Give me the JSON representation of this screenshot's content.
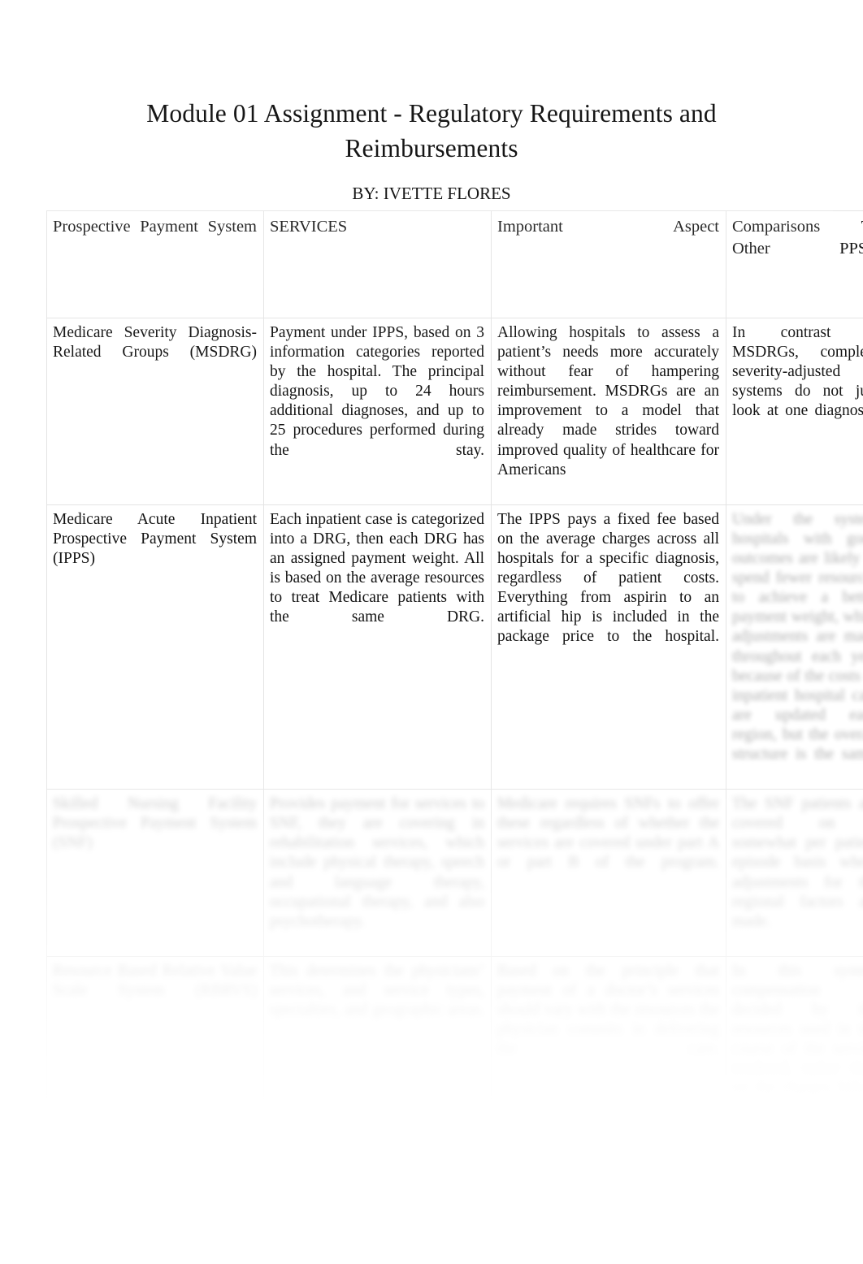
{
  "document": {
    "title": "Module 01 Assignment - Regulatory Requirements and Reimbursements",
    "byline": "BY: IVETTE FLORES"
  },
  "table": {
    "headers": [
      "Prospective Payment System",
      "SERVICES",
      "Important Aspect",
      "Comparisons To Other PPS’s"
    ],
    "rows": [
      {
        "system": "Medicare Severity Diagnosis-Related Groups (MSDRG)",
        "services": "Payment under IPPS, based on 3 information categories reported by the hospital. The principal diagnosis, up to 24 hours additional diagnoses, and up to 25 procedures performed during the stay.",
        "important_aspect": "Allowing hospitals to assess a patient’s needs more accurately without fear of hampering reimbursement. MSDRGs are an improvement to a model that already made strides toward improved quality of healthcare for Americans",
        "comparisons": "In contrast to MSDRGs, complete severity-adjusted systems do not just look at one diagnosis."
      },
      {
        "system": "Medicare Acute Inpatient Prospective Payment System (IPPS)",
        "services": "Each inpatient case is categorized into a DRG, then each DRG has an assigned payment weight. All is based on the average resources to treat Medicare patients with the same DRG.",
        "important_aspect": "The IPPS pays a fixed fee based on the average charges across all hospitals for a specific diagnosis, regardless of patient costs. Everything from aspirin to an artificial hip is included in the package price to the hospital.",
        "comparisons": "Under the system hospitals with good outcomes are likely to spend fewer resources to achieve a better payment weight, while adjustments are made throughout each year because of the costs of inpatient hospital care are updated each region, but the overall structure is the same."
      },
      {
        "system": "Skilled Nursing Facility Prospective Payment System (SNF)",
        "services": "Provides payment for services to SNF, they are covering in rehabilitation services, which include physical therapy, speech and language therapy, occupational therapy, and also psychotherapy.",
        "important_aspect": "Medicare requires SNFs to offer these regardless of whether the services are covered under part A or part B of the program.",
        "comparisons": "The SNF patients are covered on a somewhat per patient episode basis where adjustments for the regional factors are made."
      },
      {
        "system": "Resource Based Relative Value Scale System (RBRVS)",
        "services": "This determines the physicians’ services, and service types, specialties, and geographic areas.",
        "important_aspect": "Based on the principle that payment of a doctor’s services should vary with the resources the physician commits in delivering the care.",
        "comparisons": "In this system compensation is decided by the resources used in the course of the service rendered, rather than on the charges billed."
      }
    ]
  },
  "render_note": {
    "legibility": "Rows three and four and the fourth column of row two are faded and blurred in the source scan and are not fully legible."
  }
}
